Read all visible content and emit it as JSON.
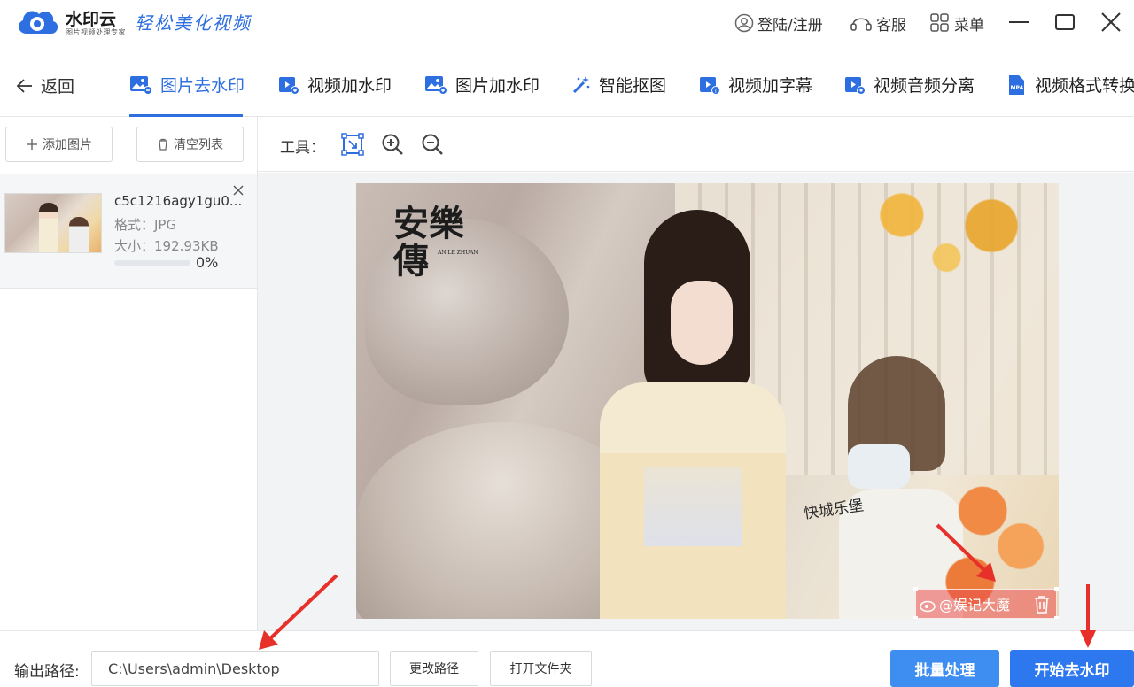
{
  "app": {
    "name": "水印云",
    "subtitle": "图片视频处理专家",
    "slogan": "轻松美化视频",
    "brand_color": "#2d6ee0"
  },
  "header": {
    "login_label": "登陆/注册",
    "service_label": "客服",
    "menu_label": "菜单"
  },
  "tabs": {
    "back_label": "返回",
    "items": [
      {
        "label": "图片去水印",
        "icon": "image-icon",
        "active": true
      },
      {
        "label": "视频加水印",
        "icon": "video-add-icon",
        "active": false
      },
      {
        "label": "图片加水印",
        "icon": "image-add-icon",
        "active": false
      },
      {
        "label": "智能抠图",
        "icon": "magic-wand-icon",
        "active": false
      },
      {
        "label": "视频加字幕",
        "icon": "video-subtitle-icon",
        "active": false
      },
      {
        "label": "视频音频分离",
        "icon": "video-audio-icon",
        "active": false
      },
      {
        "label": "视频格式转换",
        "icon": "mp4-file-icon",
        "active": false
      }
    ]
  },
  "sidebar": {
    "add_label": "添加图片",
    "clear_label": "清空列表",
    "file": {
      "name": "c5c1216agy1gu0...",
      "format": "格式：JPG",
      "size": "大小：192.93KB",
      "progress_text": "0%",
      "progress": 0
    }
  },
  "toolbar": {
    "label": "工具：",
    "tools": [
      "select-area-icon",
      "zoom-in-icon",
      "zoom-out-icon"
    ]
  },
  "preview": {
    "watermark_logo": "安樂傳",
    "watermark_logo_en": "AN LE ZHUAN",
    "watermark_castle": "快城乐堡",
    "selected_watermark_text": "@娱记大魔"
  },
  "bottom": {
    "output_label": "输出路径:",
    "output_path": "C:\\Users\\admin\\Desktop",
    "change_path_label": "更改路径",
    "open_folder_label": "打开文件夹",
    "batch_label": "批量处理",
    "start_label": "开始去水印"
  },
  "colors": {
    "accent": "#2d6ee0",
    "annotation_arrow": "#e8302a",
    "selection_fill": "#eb5050"
  }
}
